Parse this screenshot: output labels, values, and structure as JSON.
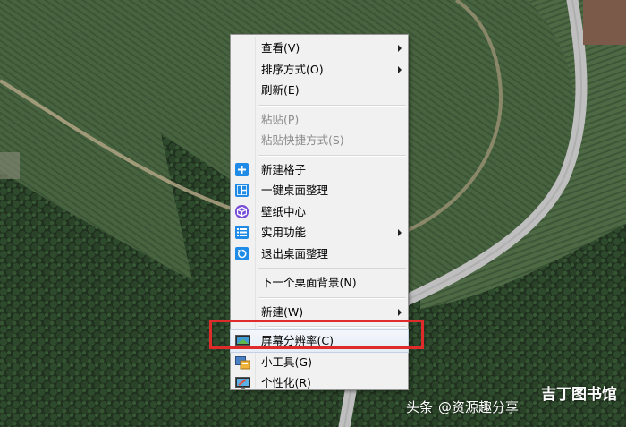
{
  "menu": {
    "items": [
      {
        "label": "查看(V)",
        "submenu": true,
        "disabled": false
      },
      {
        "label": "排序方式(O)",
        "submenu": true,
        "disabled": false
      },
      {
        "label": "刷新(E)",
        "submenu": false,
        "disabled": false
      },
      {
        "label": "粘贴(P)",
        "submenu": false,
        "disabled": true
      },
      {
        "label": "粘贴快捷方式(S)",
        "submenu": false,
        "disabled": true
      },
      {
        "label": "新建格子",
        "icon": "plus-icon"
      },
      {
        "label": "一键桌面整理",
        "icon": "layout-icon"
      },
      {
        "label": "壁纸中心",
        "icon": "cube-icon"
      },
      {
        "label": "实用功能",
        "icon": "list-icon",
        "submenu": true
      },
      {
        "label": "退出桌面整理",
        "icon": "exit-icon"
      },
      {
        "label": "下一个桌面背景(N)"
      },
      {
        "label": "新建(W)",
        "submenu": true
      },
      {
        "label": "屏幕分辨率(C)",
        "icon": "monitor-icon",
        "highlighted": true
      },
      {
        "label": "小工具(G)",
        "icon": "gadgets-icon"
      },
      {
        "label": "个性化(R)",
        "icon": "personalize-icon"
      }
    ]
  },
  "watermark": {
    "prefix": "头条",
    "text": "@资源趣分享",
    "brand": "吉丁图书馆"
  },
  "colors": {
    "highlight_box": "#e02b2b",
    "icon_blue": "#1f8be6"
  }
}
